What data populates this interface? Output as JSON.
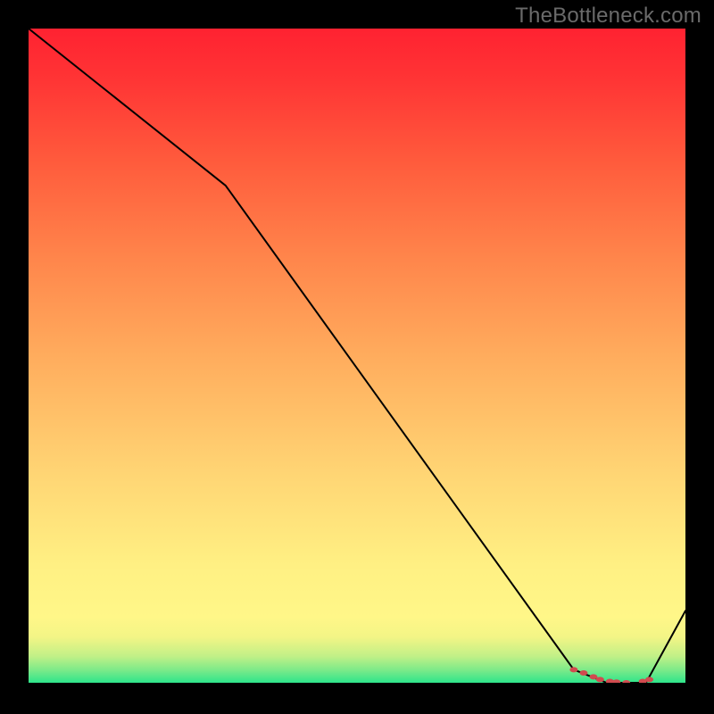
{
  "watermark": "TheBottleneck.com",
  "chart_data": {
    "type": "line",
    "title": "",
    "xlabel": "",
    "ylabel": "",
    "xlim": [
      0,
      100
    ],
    "ylim": [
      0,
      100
    ],
    "grid": false,
    "series": [
      {
        "name": "curve",
        "x": [
          0,
          30,
          83,
          88,
          94,
          100
        ],
        "y": [
          100,
          76,
          2,
          0,
          0,
          11
        ]
      }
    ],
    "gradient_stops": [
      {
        "offset": 0.0,
        "color": "#2ee58b"
      },
      {
        "offset": 0.02,
        "color": "#7eea89"
      },
      {
        "offset": 0.04,
        "color": "#c0f087"
      },
      {
        "offset": 0.07,
        "color": "#f3f586"
      },
      {
        "offset": 0.1,
        "color": "#fff788"
      },
      {
        "offset": 0.18,
        "color": "#fff083"
      },
      {
        "offset": 0.32,
        "color": "#ffd574"
      },
      {
        "offset": 0.5,
        "color": "#ffac5d"
      },
      {
        "offset": 0.65,
        "color": "#ff854b"
      },
      {
        "offset": 0.8,
        "color": "#ff5a3c"
      },
      {
        "offset": 0.92,
        "color": "#ff3535"
      },
      {
        "offset": 1.0,
        "color": "#ff2231"
      }
    ],
    "markers": [
      {
        "x": 83.0,
        "y": 2.0
      },
      {
        "x": 84.5,
        "y": 1.5
      },
      {
        "x": 86.0,
        "y": 0.9
      },
      {
        "x": 87.0,
        "y": 0.5
      },
      {
        "x": 88.5,
        "y": 0.2
      },
      {
        "x": 89.5,
        "y": 0.1
      },
      {
        "x": 91.0,
        "y": 0.0
      },
      {
        "x": 93.5,
        "y": 0.2
      },
      {
        "x": 94.5,
        "y": 0.5
      }
    ],
    "marker_color": "#d14b4f"
  }
}
